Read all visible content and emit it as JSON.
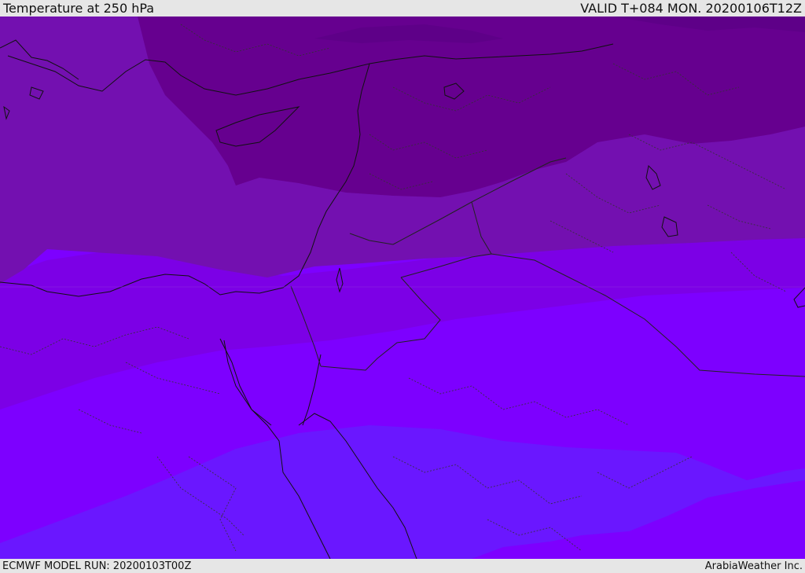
{
  "header": {
    "title": "Temperature at 250 hPa",
    "valid_time": "VALID T+084 MON. 20200106T12Z"
  },
  "footer": {
    "model_run": "ECMWF MODEL RUN: 20200103T00Z",
    "credit": "ArabiaWeather Inc."
  },
  "colors": {
    "band_darkest": "#66008f",
    "band_dark": "#7310b0",
    "band_mid": "#7c00e6",
    "band_light": "#7d00ff",
    "band_lightest": "#6a17ff",
    "coastline": "#111111",
    "border": "#333333"
  }
}
